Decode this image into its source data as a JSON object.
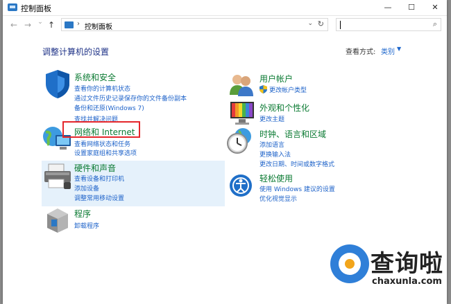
{
  "window": {
    "title": "控制面板",
    "minimize": "—",
    "maximize": "☐",
    "close": "✕"
  },
  "address": {
    "back": "←",
    "forward": "→",
    "recent": "⌄",
    "up": "↑",
    "separator": "›",
    "path": "控制面板",
    "dropdown": "⌄",
    "refresh": "↻",
    "search_icon": "⌕"
  },
  "heading": "调整计算机的设置",
  "view_by": {
    "label": "查看方式:",
    "value": "类别",
    "arrow": "▼"
  },
  "left_categories": [
    {
      "title": "系统和安全",
      "icon": "shield-icon",
      "links": [
        "查看你的计算机状态",
        "通过文件历史记录保存你的文件备份副本",
        "备份和还原(Windows 7)",
        "查找并解决问题"
      ]
    },
    {
      "title": "网络和 Internet",
      "icon": "network-globe-icon",
      "links": [
        "查看网络状态和任务",
        "设置家庭组和共享选项"
      ]
    },
    {
      "title": "硬件和声音",
      "icon": "printer-icon",
      "links": [
        "查看设备和打印机",
        "添加设备",
        "调整常用移动设置"
      ]
    },
    {
      "title": "程序",
      "icon": "program-box-icon",
      "links": [
        "卸载程序"
      ]
    }
  ],
  "right_categories": [
    {
      "title": "用户帐户",
      "icon": "users-icon",
      "links": [
        "更改帐户类型"
      ]
    },
    {
      "title": "外观和个性化",
      "icon": "monitor-palette-icon",
      "links": [
        "更改主题"
      ]
    },
    {
      "title": "时钟、语言和区域",
      "icon": "clock-globe-icon",
      "links": [
        "添加语言",
        "更换输入法",
        "更改日期、时间或数字格式"
      ]
    },
    {
      "title": "轻松使用",
      "icon": "ease-of-access-icon",
      "links": [
        "使用 Windows 建议的设置",
        "优化视觉显示"
      ]
    }
  ],
  "watermark": {
    "text": "查询啦",
    "url": "chaxunla.com"
  },
  "colors": {
    "category_title": "#0a7a32",
    "link": "#1d62c9",
    "heading": "#1e3287",
    "highlight": "#e5f1fb",
    "annotation": "#e5262b"
  }
}
